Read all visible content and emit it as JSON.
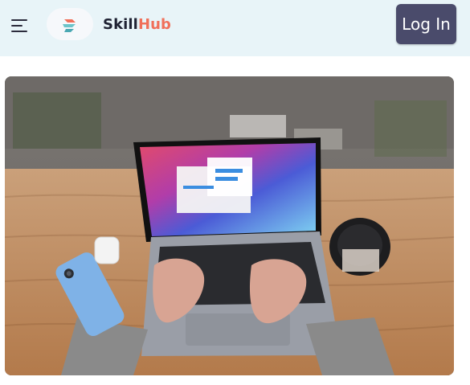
{
  "header": {
    "brand_part1": "Skill",
    "brand_part2": "Hub",
    "login_label": "Log In"
  },
  "colors": {
    "header_bg": "#e8f4f8",
    "brand_dark": "#1f2233",
    "brand_accent": "#f0705a",
    "login_bg": "#4a4b6b"
  },
  "icons": {
    "menu": "hamburger-menu-icon",
    "logo": "skillhub-logo-icon"
  },
  "hero": {
    "subject": "laptop-on-wooden-desk-photo"
  }
}
